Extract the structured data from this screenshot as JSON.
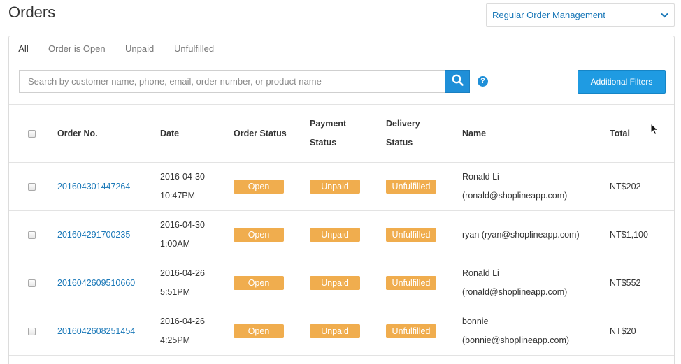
{
  "page": {
    "title": "Orders"
  },
  "mode_select": {
    "value": "Regular Order Management"
  },
  "tabs": [
    {
      "label": "All"
    },
    {
      "label": "Order is Open"
    },
    {
      "label": "Unpaid"
    },
    {
      "label": "Unfulfilled"
    }
  ],
  "search": {
    "placeholder": "Search by customer name, phone, email, order number, or product name",
    "value": ""
  },
  "help": {
    "glyph": "?"
  },
  "filters": {
    "label": "Additional Filters"
  },
  "table": {
    "headers": {
      "order_no": "Order No.",
      "date": "Date",
      "order_status": "Order Status",
      "payment_status_1": "Payment",
      "payment_status_2": "Status",
      "delivery_status_1": "Delivery",
      "delivery_status_2": "Status",
      "name": "Name",
      "total": "Total"
    },
    "rows": [
      {
        "order_no": "201604301447264",
        "date": "2016-04-30",
        "time": "10:47PM",
        "order_status": "Open",
        "payment_status": "Unpaid",
        "delivery_status": "Unfulfilled",
        "name_line1": "Ronald Li",
        "name_line2": "(ronald@shoplineapp.com)",
        "total": "NT$202"
      },
      {
        "order_no": "201604291700235",
        "date": "2016-04-30",
        "time": "1:00AM",
        "order_status": "Open",
        "payment_status": "Unpaid",
        "delivery_status": "Unfulfilled",
        "name_line1": "ryan (ryan@shoplineapp.com)",
        "name_line2": "",
        "total": "NT$1,100"
      },
      {
        "order_no": "2016042609510660",
        "date": "2016-04-26",
        "time": "5:51PM",
        "order_status": "Open",
        "payment_status": "Unpaid",
        "delivery_status": "Unfulfilled",
        "name_line1": "Ronald Li",
        "name_line2": "(ronald@shoplineapp.com)",
        "total": "NT$552"
      },
      {
        "order_no": "2016042608251454",
        "date": "2016-04-26",
        "time": "4:25PM",
        "order_status": "Open",
        "payment_status": "Unpaid",
        "delivery_status": "Unfulfilled",
        "name_line1": "bonnie",
        "name_line2": "(bonnie@shoplineapp.com)",
        "total": "NT$20"
      }
    ]
  },
  "colors": {
    "accent": "#1f8fd8",
    "link": "#1a78b8",
    "status_badge": "#f0ad4e"
  }
}
